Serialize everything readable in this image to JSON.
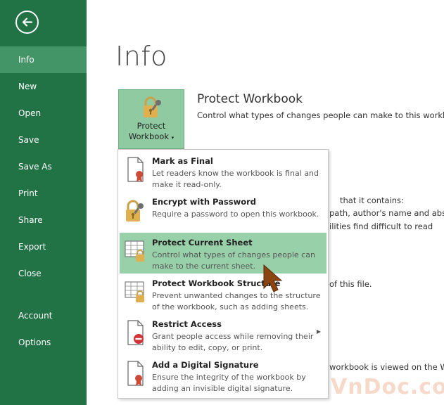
{
  "nav": {
    "items": [
      {
        "label": "Info",
        "selected": true
      },
      {
        "label": "New"
      },
      {
        "label": "Open"
      },
      {
        "label": "Save"
      },
      {
        "label": "Save As"
      },
      {
        "label": "Print"
      },
      {
        "label": "Share"
      },
      {
        "label": "Export"
      },
      {
        "label": "Close"
      },
      {
        "label": "Account"
      },
      {
        "label": "Options"
      }
    ],
    "back_icon": "back-arrow-icon"
  },
  "main": {
    "title": "Info",
    "protect_button": {
      "line1": "Protect",
      "line2": "Workbook",
      "icon": "lock-key-icon"
    },
    "protect_section_title": "Protect Workbook",
    "protect_section_desc": "Control what types of changes people can make to this workbook.",
    "background_lines": [
      "that it contains:",
      "path, author's name and absolut",
      "ilities find difficult to read",
      "of this file.",
      "workbook is viewed on the Web."
    ]
  },
  "menu": {
    "items": [
      {
        "title": "Mark as Final",
        "desc": "Let readers know the workbook is final and make it read-only.",
        "icon": "document-ribbon-icon"
      },
      {
        "title": "Encrypt with Password",
        "desc": "Require a password to open this workbook.",
        "icon": "lock-key-icon"
      },
      {
        "title": "Protect Current Sheet",
        "desc": "Control what types of changes people can make to the current sheet.",
        "icon": "sheet-lock-icon",
        "highlighted": true
      },
      {
        "title": "Protect Workbook Structure",
        "desc": "Prevent unwanted changes to the structure of the workbook, such as adding sheets.",
        "icon": "workbook-lock-icon"
      },
      {
        "title": "Restrict Access",
        "desc": "Grant people access while removing their ability to edit, copy, or print.",
        "icon": "document-restrict-icon",
        "has_submenu": true
      },
      {
        "title": "Add a Digital Signature",
        "desc": "Ensure the integrity of the workbook by adding an invisible digital signature.",
        "icon": "document-signature-icon"
      }
    ]
  },
  "watermark": "VnDoc.com",
  "colors": {
    "nav_bg": "#217346",
    "nav_selected": "#439467",
    "button_bg": "#8fcaa1",
    "menu_highlight": "#98d0a9",
    "cursor": "#8b4513"
  }
}
